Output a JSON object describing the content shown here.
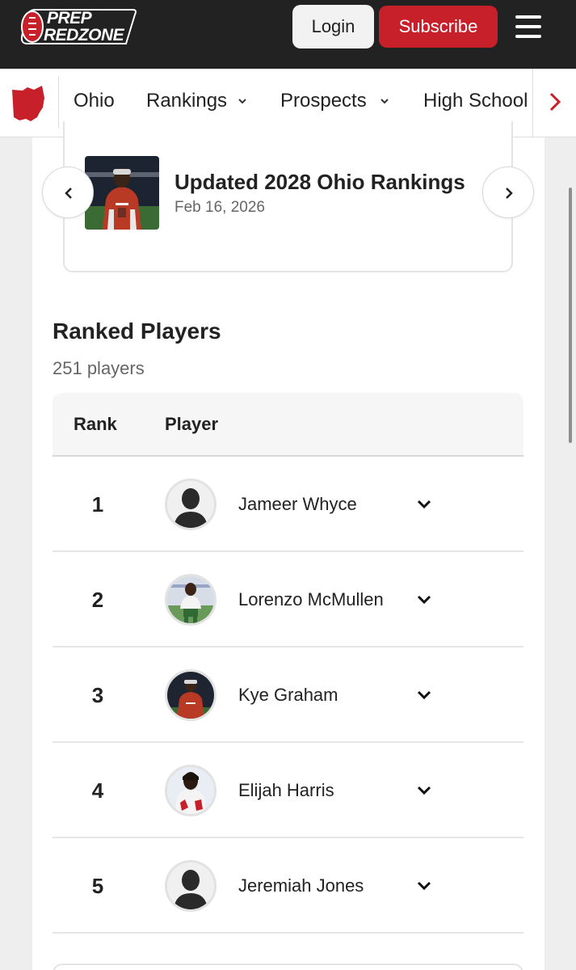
{
  "header": {
    "logo_line1": "PREP",
    "logo_line2": "REDZONE",
    "login_label": "Login",
    "subscribe_label": "Subscribe",
    "menu_icon": "hamburger-icon"
  },
  "nav": {
    "state_icon": "ohio-state-icon",
    "items": [
      {
        "label": "Ohio",
        "has_caret": false
      },
      {
        "label": "Rankings",
        "has_caret": true
      },
      {
        "label": "Prospects",
        "has_caret": true
      },
      {
        "label": "High School",
        "has_caret": false
      }
    ],
    "more_icon": "chevron-right-icon"
  },
  "carousel": {
    "title": "Updated 2028 Ohio Rankings",
    "date": "Feb 16, 2026",
    "prev_icon": "chevron-left-icon",
    "next_icon": "chevron-right-icon"
  },
  "rankings": {
    "title": "Ranked Players",
    "count": "251 players",
    "columns": [
      "Rank",
      "Player"
    ],
    "players": [
      {
        "rank": "1",
        "name": "Jameer Whyce",
        "photo": "placeholder"
      },
      {
        "rank": "2",
        "name": "Lorenzo McMullen",
        "photo": "photo"
      },
      {
        "rank": "3",
        "name": "Kye Graham",
        "photo": "photo"
      },
      {
        "rank": "4",
        "name": "Elijah Harris",
        "photo": "photo"
      },
      {
        "rank": "5",
        "name": "Jeremiah Jones",
        "photo": "placeholder"
      }
    ]
  },
  "colors": {
    "brand_red": "#c8202a",
    "header_bg": "#222222"
  }
}
